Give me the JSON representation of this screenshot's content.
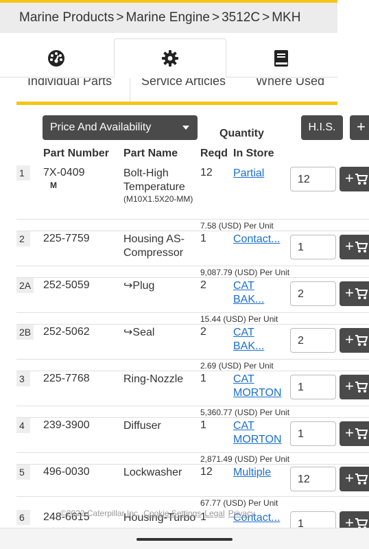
{
  "breadcrumb": [
    "Marine Products",
    "Marine Engine",
    "3512C",
    "MKH"
  ],
  "icon_tabs": [
    {
      "icon": "gauge-icon",
      "active": false
    },
    {
      "icon": "gear-icon",
      "active": true
    },
    {
      "icon": "book-icon",
      "active": false
    }
  ],
  "text_tabs": [
    "Individual Parts",
    "Service Articles",
    "Where Used"
  ],
  "toolbar": {
    "price_availability": "Price And Availability",
    "quantity_heading": "Quantity",
    "his_label": "H.I.S.",
    "add_label": "+"
  },
  "columns": {
    "part_number": "Part Number",
    "part_name": "Part Name",
    "reqd": "Reqd",
    "in_store": "In Store"
  },
  "rows": [
    {
      "idx": "1",
      "part_number": "7X-0409",
      "sub": "M",
      "name": "Bolt-High Temperature",
      "name_sub": "(M10X1.5X20-MM)",
      "reqd": "12",
      "store": "Partial",
      "qty": "12",
      "price": "7.58 (USD) Per Unit"
    },
    {
      "idx": "2",
      "part_number": "225-7759",
      "sub": "",
      "name": "Housing AS-Compressor",
      "name_sub": "",
      "reqd": "1",
      "store": "Contact...",
      "qty": "1",
      "price": "9,087.79 (USD) Per Unit"
    },
    {
      "idx": "2A",
      "part_number": "252-5059",
      "sub": "",
      "name": "↪Plug",
      "name_sub": "",
      "reqd": "2",
      "store": "CAT BAK...",
      "qty": "2",
      "price": "15.44 (USD) Per Unit"
    },
    {
      "idx": "2B",
      "part_number": "252-5062",
      "sub": "",
      "name": "↪Seal",
      "name_sub": "",
      "reqd": "2",
      "store": "CAT BAK...",
      "qty": "2",
      "price": "2.69 (USD) Per Unit"
    },
    {
      "idx": "3",
      "part_number": "225-7768",
      "sub": "",
      "name": "Ring-Nozzle",
      "name_sub": "",
      "reqd": "1",
      "store": "CAT MORTON",
      "qty": "1",
      "price": "5,360.77 (USD) Per Unit"
    },
    {
      "idx": "4",
      "part_number": "239-3900",
      "sub": "",
      "name": "Diffuser",
      "name_sub": "",
      "reqd": "1",
      "store": "CAT MORTON",
      "qty": "1",
      "price": "2,871.49 (USD) Per Unit"
    },
    {
      "idx": "5",
      "part_number": "496-0030",
      "sub": "",
      "name": "Lockwasher",
      "name_sub": "",
      "reqd": "12",
      "store": "Multiple",
      "qty": "12",
      "price": "67.77 (USD) Per Unit"
    },
    {
      "idx": "6",
      "part_number": "248-6615",
      "sub": "",
      "name": "Housing-Turbo",
      "name_sub": "",
      "reqd": "1",
      "store": "Contact...",
      "qty": "1",
      "price": ""
    }
  ],
  "footer": {
    "copyright": "©2022 Caterpillar Inc.",
    "cookie": "Cookie Settings",
    "legal": "Legal",
    "privacy": "Privacy"
  },
  "colors": {
    "accent": "#f5c518",
    "button": "#4a4a4a",
    "link": "#1a6fd1"
  }
}
